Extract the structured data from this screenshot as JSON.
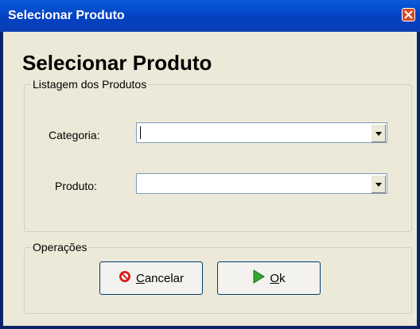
{
  "window": {
    "title": "Selecionar Produto"
  },
  "heading": "Selecionar Produto",
  "list_group": {
    "legend": "Listagem dos Produtos",
    "categoria_label": "Categoria:",
    "categoria_value": "",
    "produto_label": "Produto:",
    "produto_value": ""
  },
  "ops_group": {
    "legend": "Operações",
    "cancel": {
      "mnemonic": "C",
      "rest": "ancelar",
      "icon": "no-entry-icon"
    },
    "ok": {
      "mnemonic": "O",
      "rest": "k",
      "icon": "play-arrow-icon"
    }
  },
  "colors": {
    "titlebar": "#0A5BDC",
    "dialog_bg": "#ECE9D8",
    "close": "#D74A24",
    "ok_icon": "#2EA82E",
    "cancel_icon": "#D81E1E"
  }
}
